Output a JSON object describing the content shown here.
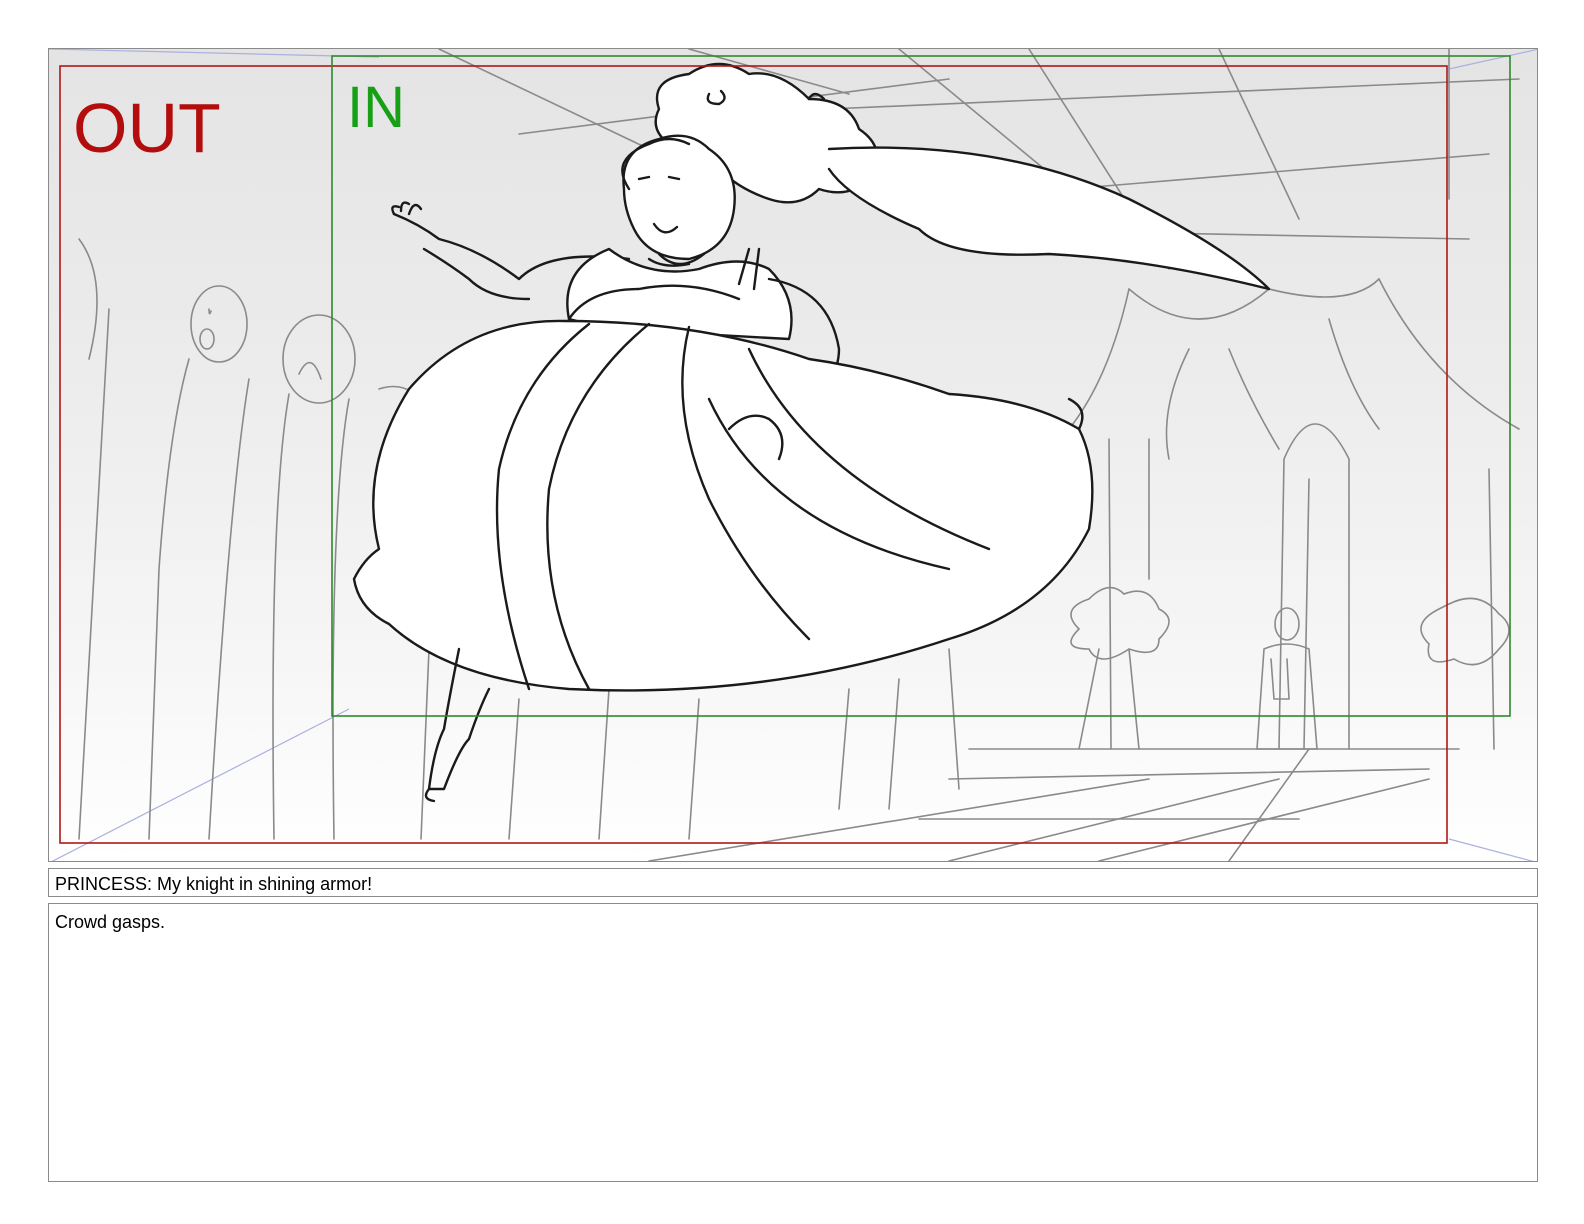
{
  "storyboard_panel": {
    "out_label": "OUT",
    "in_label": "IN",
    "colors": {
      "out_frame": "#b01818",
      "in_frame": "#2e8a2e",
      "out_text": "#b30d0d",
      "in_text": "#17a017",
      "perspective_guides": "#aab0e0",
      "sketch_dark": "#1a1a1a",
      "sketch_light": "#7a7a7a"
    },
    "drawing_icon": "princess-leaping-sketch"
  },
  "dialogue": {
    "text": "PRINCESS: My knight in shining armor!"
  },
  "action_notes": {
    "text": "Crowd gasps."
  }
}
